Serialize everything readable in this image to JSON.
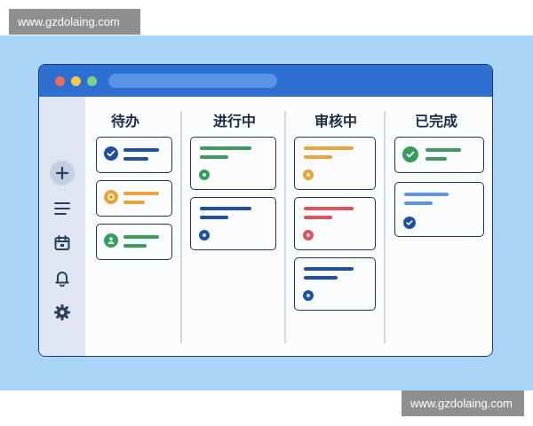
{
  "watermark": {
    "top": "www.gzdolaing.com",
    "bottom": "www.gzdolaing.com"
  },
  "sidebar": {
    "items": [
      {
        "icon": "plus-icon"
      },
      {
        "icon": "menu-icon"
      },
      {
        "icon": "calendar-icon"
      },
      {
        "icon": "bell-icon"
      },
      {
        "icon": "gear-icon"
      }
    ]
  },
  "board": {
    "columns": [
      {
        "title": "待办",
        "cards": [
          {
            "color": "#4a90e8",
            "icon": "check-icon"
          },
          {
            "color": "#fcd86a",
            "icon": "gear-icon"
          },
          {
            "color": "#7fcf96",
            "icon": "user-icon"
          }
        ]
      },
      {
        "title": "进行中",
        "cards": [
          {
            "color": "#7fcf96",
            "icon": "status-dot-icon"
          },
          {
            "color": "#4a90e8",
            "icon": "status-dot-icon"
          }
        ]
      },
      {
        "title": "审核中",
        "cards": [
          {
            "color": "#fcd86a",
            "icon": "status-dot-icon"
          },
          {
            "color": "#f3a0a4",
            "icon": "status-dot-icon"
          },
          {
            "color": "#4a90e8",
            "icon": "status-dot-icon"
          }
        ]
      },
      {
        "title": "已完成",
        "cards": [
          {
            "color": "#7fcf96",
            "icon": "check-icon"
          },
          {
            "color": "#9fcaf6",
            "icon": "check-icon"
          }
        ]
      }
    ]
  },
  "colors": {
    "accent": "#2e6fd1",
    "background": "#a9d4f6"
  }
}
